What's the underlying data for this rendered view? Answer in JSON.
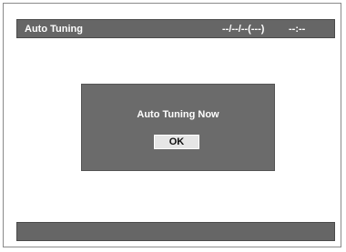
{
  "header": {
    "title": "Auto Tuning",
    "date": "--/--/--(---)",
    "time": "--:--"
  },
  "dialog": {
    "message": "Auto Tuning Now",
    "ok_label": "OK"
  },
  "colors": {
    "bar": "#666666",
    "dialog": "#6b6b6b",
    "button": "#e6e6e6",
    "text_light": "#ffffff"
  }
}
